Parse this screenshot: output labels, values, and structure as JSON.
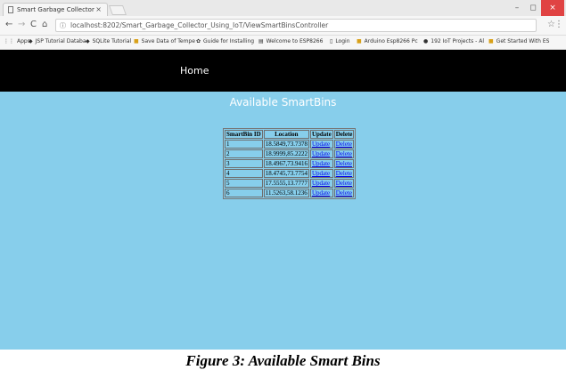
{
  "browser": {
    "tab_title": "Smart Garbage Collector",
    "tab_close": "×",
    "win_min": "–",
    "win_max": "◻",
    "win_close": "×",
    "back": "←",
    "forward": "→",
    "reload": "C",
    "home": "⌂",
    "info": "ⓘ",
    "url": "localhost:8202/Smart_Garbage_Collector_Using_IoT/ViewSmartBinsController",
    "star": "☆",
    "menu": "⋮"
  },
  "bookmarks": [
    {
      "icon": "⋮⋮",
      "label": "Apps"
    },
    {
      "icon": "◆",
      "label": "JSP Tutorial Databa"
    },
    {
      "icon": "◆",
      "label": "SQLite Tutorial"
    },
    {
      "icon": "■",
      "label": "Save Data of Tempe"
    },
    {
      "icon": "✿",
      "label": "Guide for Installing"
    },
    {
      "icon": "▤",
      "label": "Welcome to ESP8266"
    },
    {
      "icon": "▯",
      "label": "Login"
    },
    {
      "icon": "■",
      "label": "Arduino Esp8266 Pc"
    },
    {
      "icon": "●",
      "label": "192 IoT Projects - Al"
    },
    {
      "icon": "■",
      "label": "Get Started With ES"
    }
  ],
  "navbar": {
    "home": "Home"
  },
  "page": {
    "heading": "Available SmartBins"
  },
  "table": {
    "headers": [
      "SmartBin ID",
      "Location",
      "Update",
      "Delete"
    ],
    "rows": [
      {
        "id": "1",
        "location": "18.5849,73.7378",
        "update": "Update",
        "delete": "Delete"
      },
      {
        "id": "2",
        "location": "18.9999,85.2222",
        "update": "Update",
        "delete": "Delete"
      },
      {
        "id": "3",
        "location": "18.4967,73.9416",
        "update": "Update",
        "delete": "Delete"
      },
      {
        "id": "4",
        "location": "18.4745,73.7754",
        "update": "Update",
        "delete": "Delete"
      },
      {
        "id": "5",
        "location": "17.5555,13.7777",
        "update": "Update",
        "delete": "Delete"
      },
      {
        "id": "6",
        "location": "11.5263,58.1236",
        "update": "Update",
        "delete": "Delete"
      }
    ]
  },
  "figure_caption": "Figure 3: Available Smart Bins",
  "colors": {
    "page_bg": "#87ceeb",
    "navbar_bg": "#000000",
    "link": "#0000ee"
  }
}
